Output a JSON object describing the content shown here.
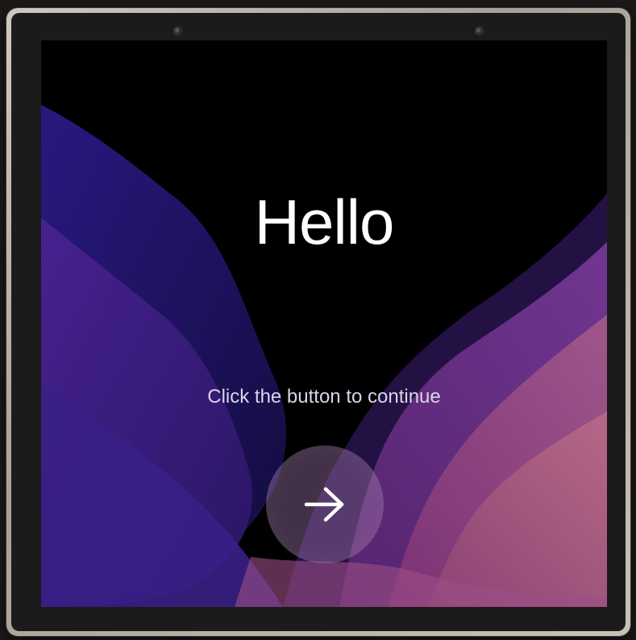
{
  "screen": {
    "greeting": "Hello",
    "subtitle": "Click the button to continue"
  },
  "continue_button": {
    "icon": "arrow-right-icon"
  },
  "colors": {
    "background": "#000000",
    "wave_indigo": "#2b1a78",
    "wave_purple": "#5a2a94",
    "wave_magenta": "#8a3a8e",
    "wave_rose": "#b0607a",
    "text": "#ffffff",
    "button_fill": "#8c6a9a"
  },
  "device": {
    "cameras": [
      "camera-left",
      "camera-right"
    ]
  }
}
